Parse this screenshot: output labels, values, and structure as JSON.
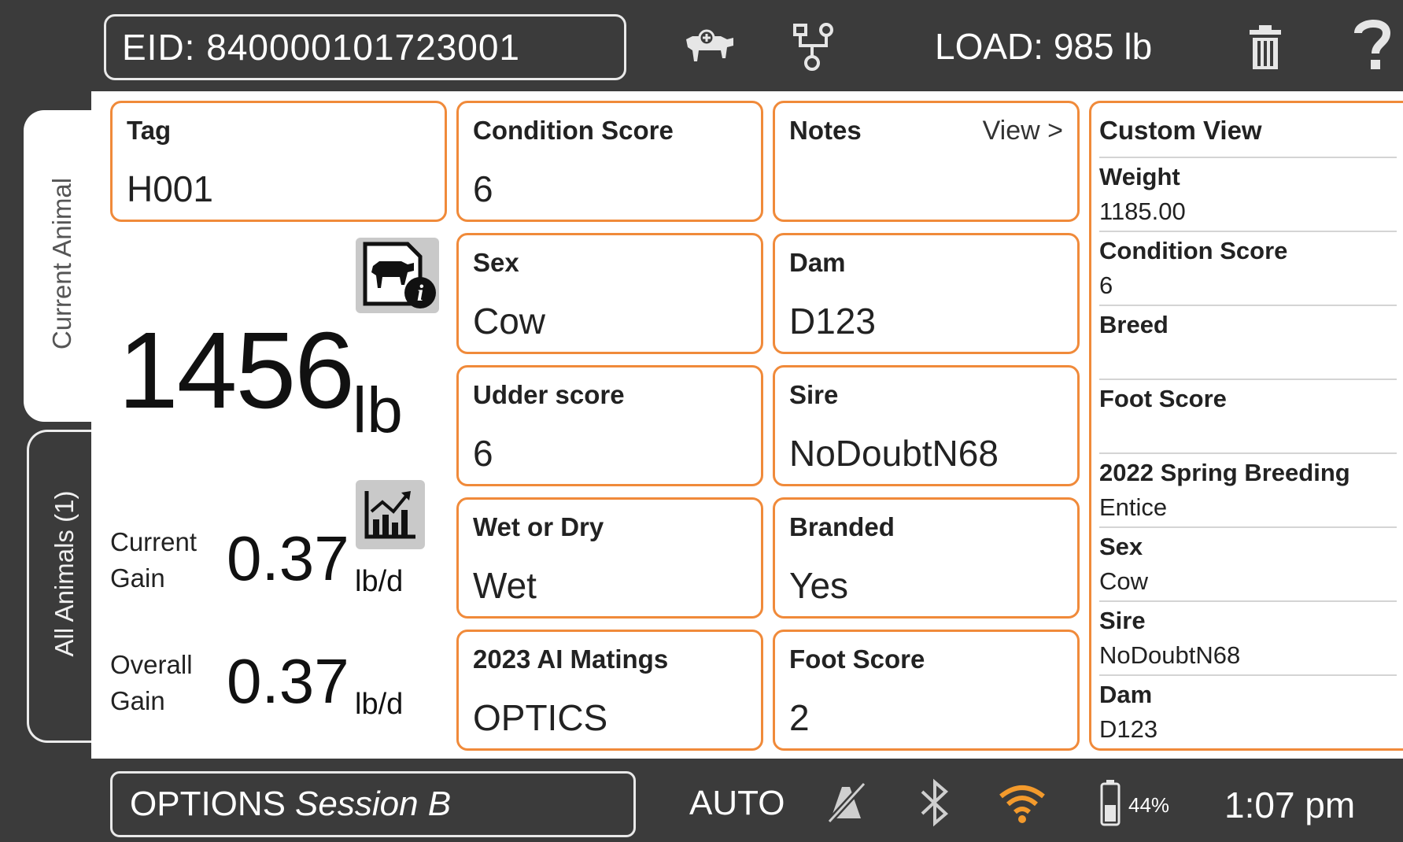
{
  "topbar": {
    "eid_label": "EID: 840000101723001",
    "load_label": "LOAD: 985 lb",
    "icons": [
      "cow-add-icon",
      "network-icon",
      "trash-icon",
      "help-icon"
    ]
  },
  "tabs": {
    "current": "Current Animal",
    "all": "All Animals (1)"
  },
  "weight": {
    "value": "1456",
    "unit": "lb",
    "current_gain_label_1": "Current",
    "current_gain_label_2": "Gain",
    "current_gain_value": "0.37",
    "current_gain_unit": "lb/d",
    "overall_gain_label_1": "Overall",
    "overall_gain_label_2": "Gain",
    "overall_gain_value": "0.37",
    "overall_gain_unit": "lb/d"
  },
  "cards": {
    "tag": {
      "title": "Tag",
      "value": "H001"
    },
    "condition_score": {
      "title": "Condition Score",
      "value": "6"
    },
    "notes": {
      "title": "Notes",
      "view": "View >"
    },
    "sex": {
      "title": "Sex",
      "value": "Cow"
    },
    "dam": {
      "title": "Dam",
      "value": "D123"
    },
    "udder": {
      "title": "Udder score",
      "value": "6"
    },
    "sire": {
      "title": "Sire",
      "value": "NoDoubtN68"
    },
    "wet_dry": {
      "title": "Wet or Dry",
      "value": "Wet"
    },
    "branded": {
      "title": "Branded",
      "value": "Yes"
    },
    "ai_matings": {
      "title": "2023 AI Matings",
      "value": "OPTICS"
    },
    "foot_score": {
      "title": "Foot Score",
      "value": "2"
    }
  },
  "custom_view": {
    "title": "Custom View",
    "rows": [
      {
        "label": "Weight",
        "value": "1185.00"
      },
      {
        "label": "Condition Score",
        "value": "6"
      },
      {
        "label": "Breed",
        "value": ""
      },
      {
        "label": "Foot Score",
        "value": ""
      },
      {
        "label": "2022 Spring Breeding",
        "value": "Entice"
      },
      {
        "label": "Sex",
        "value": "Cow"
      },
      {
        "label": "Sire",
        "value": "NoDoubtN68"
      },
      {
        "label": "Dam",
        "value": "D123"
      }
    ]
  },
  "bottombar": {
    "options_label": "OPTIONS",
    "session_label": "Session B",
    "auto_label": "AUTO",
    "battery_label": "44%",
    "battery_level": 0.44,
    "time_label": "1:07 pm"
  },
  "colors": {
    "frame": "#3b3b3b",
    "card_border": "#f08a3a",
    "wifi": "#f39a2c"
  }
}
